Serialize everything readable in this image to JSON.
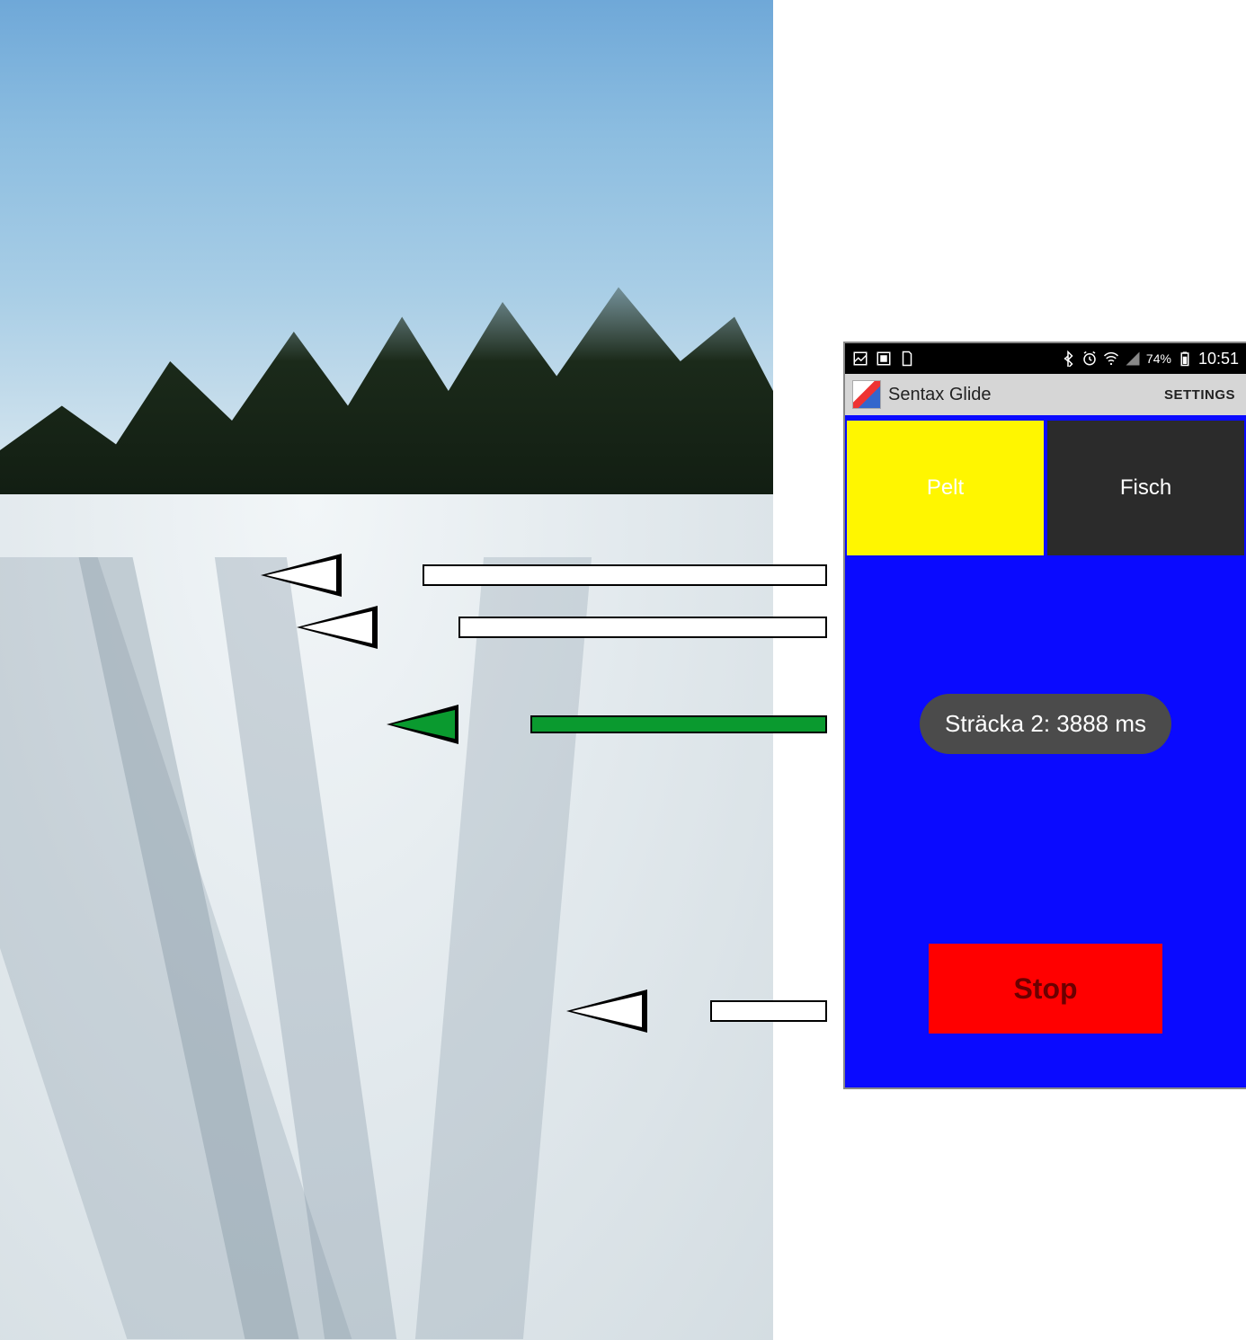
{
  "statusbar": {
    "battery_text": "74%",
    "time": "10:51"
  },
  "appbar": {
    "title": "Sentax Glide",
    "settings_label": "SETTINGS"
  },
  "tabs": {
    "left_label": "Pelt",
    "right_label": "Fisch"
  },
  "toast": {
    "text": "Sträcka 2: 3888 ms"
  },
  "controls": {
    "stop_label": "Stop"
  },
  "arrows": {
    "a1_color": "white",
    "a2_color": "white",
    "a3_color": "green",
    "a4_color": "white"
  }
}
